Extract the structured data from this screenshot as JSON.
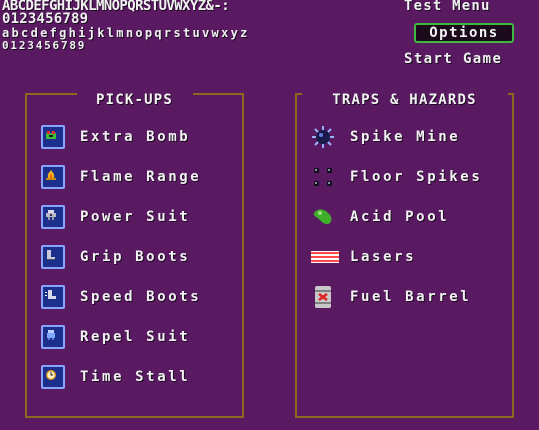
{
  "font_sample": {
    "upper": "ABCDEFGHIJKLMNOPQRSTUVWXYZ&-:",
    "digits_big": "0123456789",
    "lower": "abcdefghijklmnopqrstuvwxyz",
    "digits_small": "0123456789"
  },
  "menu": {
    "title": "Test Menu",
    "options_label": "Options",
    "start_label": "Start Game"
  },
  "pickups": {
    "title": "PICK-UPS",
    "items": [
      {
        "label": "Extra Bomb",
        "icon": "extra-bomb-icon",
        "color": "#3bbf3b"
      },
      {
        "label": "Flame Range",
        "icon": "flame-icon",
        "color": "#f2b61e"
      },
      {
        "label": "Power Suit",
        "icon": "power-suit-icon",
        "color": "#b8b8c8"
      },
      {
        "label": "Grip Boots",
        "icon": "grip-boots-icon",
        "color": "#c8c8d8"
      },
      {
        "label": "Speed Boots",
        "icon": "speed-boots-icon",
        "color": "#d8d8e8"
      },
      {
        "label": "Repel Suit",
        "icon": "repel-suit-icon",
        "color": "#7fa8ff"
      },
      {
        "label": "Time Stall",
        "icon": "clock-icon",
        "color": "#e0a020"
      }
    ]
  },
  "hazards": {
    "title": "TRAPS & HAZARDS",
    "items": [
      {
        "label": "Spike Mine",
        "icon": "spike-mine-icon",
        "color": "#2a2a6a"
      },
      {
        "label": "Floor Spikes",
        "icon": "floor-spikes-icon",
        "color": "#101020"
      },
      {
        "label": "Acid Pool",
        "icon": "acid-pool-icon",
        "color": "#3fae2a"
      },
      {
        "label": "Lasers",
        "icon": "laser-icon",
        "color": "#ff6a6a"
      },
      {
        "label": "Fuel Barrel",
        "icon": "fuel-barrel-icon",
        "color": "#c8c8c8"
      }
    ]
  }
}
